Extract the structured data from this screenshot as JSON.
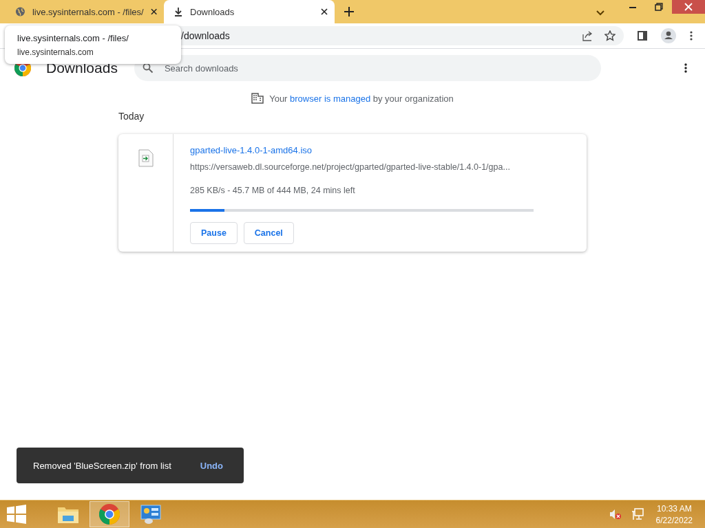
{
  "tabs": [
    {
      "label": "live.sysinternals.com - /files/",
      "selected": false
    },
    {
      "label": "Downloads",
      "selected": true
    }
  ],
  "tooltip": {
    "title": "live.sysinternals.com - /files/",
    "host": "live.sysinternals.com"
  },
  "address": "/downloads",
  "page": {
    "title": "Downloads",
    "search": {
      "placeholder": "Search downloads"
    },
    "managed_parts": [
      "Your",
      "browser is managed",
      "by your organization"
    ],
    "section": "Today",
    "download": {
      "name": "gparted-live-1.4.0-1-amd64.iso",
      "url": "https://versaweb.dl.sourceforge.net/project/gparted/gparted-live-stable/1.4.0-1/gpa...",
      "status": "285 KB/s - 45.7 MB of 444 MB, 24 mins left",
      "level": 0.1,
      "buttons": [
        "Pause",
        "Cancel"
      ]
    }
  },
  "toast": {
    "message": "Removed 'BlueScreen.zip' from list",
    "action": "Undo"
  },
  "taskbar": {
    "apps": [
      {
        "kind": "explorer",
        "selected": false
      },
      {
        "kind": "chrome",
        "selected": true
      },
      {
        "kind": "control",
        "selected": false
      }
    ],
    "time": "10:33 AM",
    "date": "6/22/2022"
  }
}
